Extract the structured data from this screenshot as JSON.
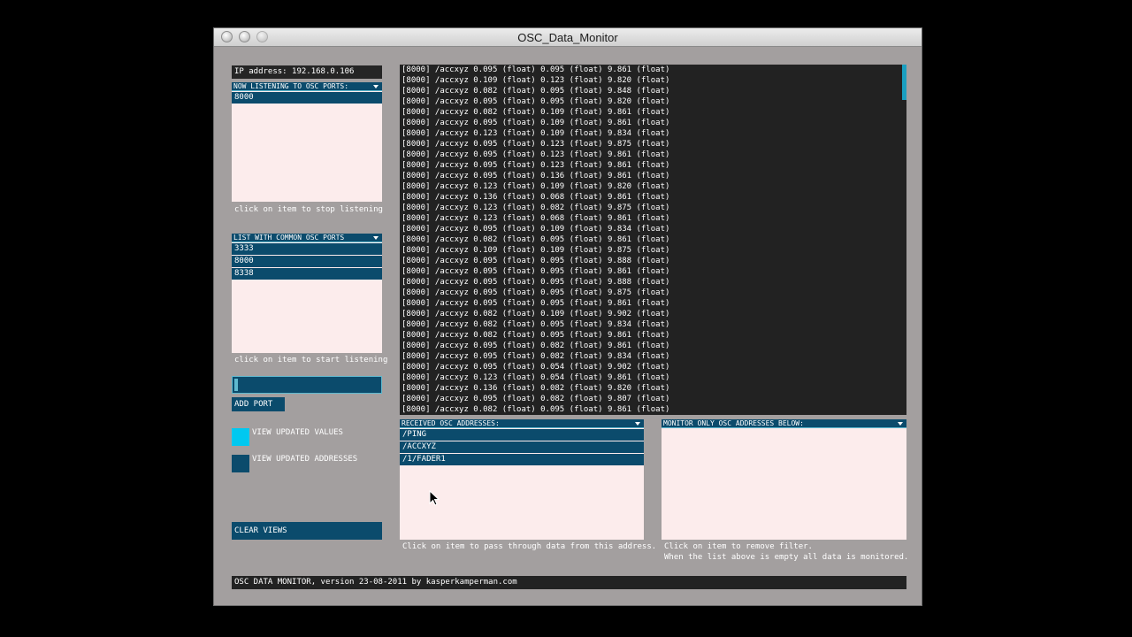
{
  "window": {
    "title": "OSC_Data_Monitor"
  },
  "ip_label": "IP address: 192.168.0.106",
  "listening": {
    "header": "NOW LISTENING TO OSC PORTS:",
    "items": [
      "8000"
    ],
    "hint": "click on item to stop listening"
  },
  "common_ports": {
    "header": "LIST WITH COMMON OSC PORTS",
    "items": [
      "3333",
      "8000",
      "8338"
    ],
    "hint": "click on item to start listening"
  },
  "port_input": {
    "value": ""
  },
  "add_port_label": "ADD PORT",
  "toggles": {
    "view_values_label": "VIEW UPDATED VALUES",
    "view_addresses_label": "VIEW UPDATED ADDRESSES",
    "values_color": "#00c8f0",
    "addresses_color": "#0b4b6c"
  },
  "clear_label": "CLEAR VIEWS",
  "console_lines": [
    "[8000] /accxyz 0.095 (float) 0.095 (float) 9.861 (float)",
    "[8000] /accxyz 0.109 (float) 0.123 (float) 9.820 (float)",
    "[8000] /accxyz 0.082 (float) 0.095 (float) 9.848 (float)",
    "[8000] /accxyz 0.095 (float) 0.095 (float) 9.820 (float)",
    "[8000] /accxyz 0.082 (float) 0.109 (float) 9.861 (float)",
    "[8000] /accxyz 0.095 (float) 0.109 (float) 9.861 (float)",
    "[8000] /accxyz 0.123 (float) 0.109 (float) 9.834 (float)",
    "[8000] /accxyz 0.095 (float) 0.123 (float) 9.875 (float)",
    "[8000] /accxyz 0.095 (float) 0.123 (float) 9.861 (float)",
    "[8000] /accxyz 0.095 (float) 0.123 (float) 9.861 (float)",
    "[8000] /accxyz 0.095 (float) 0.136 (float) 9.861 (float)",
    "[8000] /accxyz 0.123 (float) 0.109 (float) 9.820 (float)",
    "[8000] /accxyz 0.136 (float) 0.068 (float) 9.861 (float)",
    "[8000] /accxyz 0.123 (float) 0.082 (float) 9.875 (float)",
    "[8000] /accxyz 0.123 (float) 0.068 (float) 9.861 (float)",
    "[8000] /accxyz 0.095 (float) 0.109 (float) 9.834 (float)",
    "[8000] /accxyz 0.082 (float) 0.095 (float) 9.861 (float)",
    "[8000] /accxyz 0.109 (float) 0.109 (float) 9.875 (float)",
    "[8000] /accxyz 0.095 (float) 0.095 (float) 9.888 (float)",
    "[8000] /accxyz 0.095 (float) 0.095 (float) 9.861 (float)",
    "[8000] /accxyz 0.095 (float) 0.095 (float) 9.888 (float)",
    "[8000] /accxyz 0.095 (float) 0.095 (float) 9.875 (float)",
    "[8000] /accxyz 0.095 (float) 0.095 (float) 9.861 (float)",
    "[8000] /accxyz 0.082 (float) 0.109 (float) 9.902 (float)",
    "[8000] /accxyz 0.082 (float) 0.095 (float) 9.834 (float)",
    "[8000] /accxyz 0.082 (float) 0.095 (float) 9.861 (float)",
    "[8000] /accxyz 0.095 (float) 0.082 (float) 9.861 (float)",
    "[8000] /accxyz 0.095 (float) 0.082 (float) 9.834 (float)",
    "[8000] /accxyz 0.095 (float) 0.054 (float) 9.902 (float)",
    "[8000] /accxyz 0.123 (float) 0.054 (float) 9.861 (float)",
    "[8000] /accxyz 0.136 (float) 0.082 (float) 9.820 (float)",
    "[8000] /accxyz 0.095 (float) 0.082 (float) 9.807 (float)",
    "[8000] /accxyz 0.082 (float) 0.095 (float) 9.861 (float)"
  ],
  "received": {
    "header": "RECEIVED OSC ADDRESSES:",
    "items": [
      "/PING",
      "/ACCXYZ",
      "/1/FADER1"
    ],
    "hint": "Click on item to pass through data from this address."
  },
  "filter": {
    "header": "MONITOR ONLY OSC ADDRESSES BELOW:",
    "hint1": "Click on item to remove filter.",
    "hint2": "When the list above is empty all data is monitored."
  },
  "footer": "OSC DATA MONITOR, version 23-08-2011 by kasperkamperman.com"
}
